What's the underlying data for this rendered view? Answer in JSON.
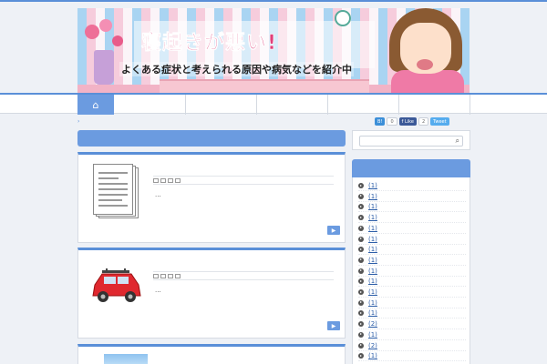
{
  "banner": {
    "title": "寝起きが悪い!",
    "subtitle": "よくある症状と考えられる原因や病気などを紹介中"
  },
  "nav": {
    "home_icon": "home-icon"
  },
  "breadcrumb": "›",
  "social": {
    "hatena_label": "B!",
    "hatena_count": "0",
    "like_label": "f Like",
    "like_count": "2",
    "tweet_label": "Tweet"
  },
  "posts": [
    {
      "excerpt": "...",
      "thumb": "document-icon",
      "more_label": "▶"
    },
    {
      "excerpt": "...",
      "thumb": "car-icon",
      "more_label": "▶"
    },
    {
      "excerpt": "",
      "thumb": "photo-thumbnail",
      "more_label": ""
    }
  ],
  "sidebar": {
    "search_icon": "search-icon",
    "archives": [
      {
        "label": " (1)"
      },
      {
        "label": " (1)"
      },
      {
        "label": " (1)"
      },
      {
        "label": " (1)"
      },
      {
        "label": " (1)"
      },
      {
        "label": " (1)"
      },
      {
        "label": " (1)"
      },
      {
        "label": " (1)"
      },
      {
        "label": " (1)"
      },
      {
        "label": " (1)"
      },
      {
        "label": " (1)"
      },
      {
        "label": " (1)"
      },
      {
        "label": " (1)"
      },
      {
        "label": " (2)"
      },
      {
        "label": " (1)"
      },
      {
        "label": " (2)"
      },
      {
        "label": " (1)"
      }
    ]
  },
  "colors": {
    "accent": "#5a8fd8",
    "accent_light": "#6b9be0",
    "background": "#eef1f6"
  }
}
